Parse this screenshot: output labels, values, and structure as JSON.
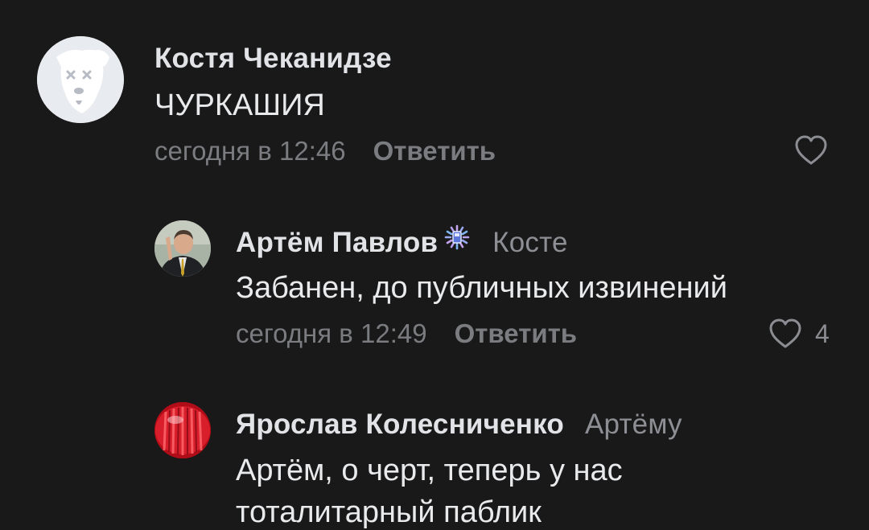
{
  "comments": [
    {
      "author": "Костя Чеканидзе",
      "reply_to": "",
      "text": "ЧУРКАШИЯ",
      "time": "сегодня в 12:46",
      "reply_label": "Ответить",
      "likes": ""
    },
    {
      "author": "Артём Павлов",
      "reply_to": "Косте",
      "text": "Забанен, до публичных извинений",
      "time": "сегодня в 12:49",
      "reply_label": "Ответить",
      "likes": "4"
    },
    {
      "author": "Ярослав Колесниченко",
      "reply_to": "Артёму",
      "text_line1": "Артём, о черт, теперь у нас",
      "text_line2": "тоталитарный паблик"
    }
  ],
  "icons": {
    "heart": "heart-icon",
    "deleted_avatar": "deleted-user-avatar-icon",
    "badge": "spiral-badge-icon"
  },
  "colors": {
    "background": "#19191a",
    "author": "#e1e3e6",
    "secondary": "#7a7c80",
    "avatar_deleted_bg": "#e8ebef",
    "avatar_red": "#c4101c"
  }
}
